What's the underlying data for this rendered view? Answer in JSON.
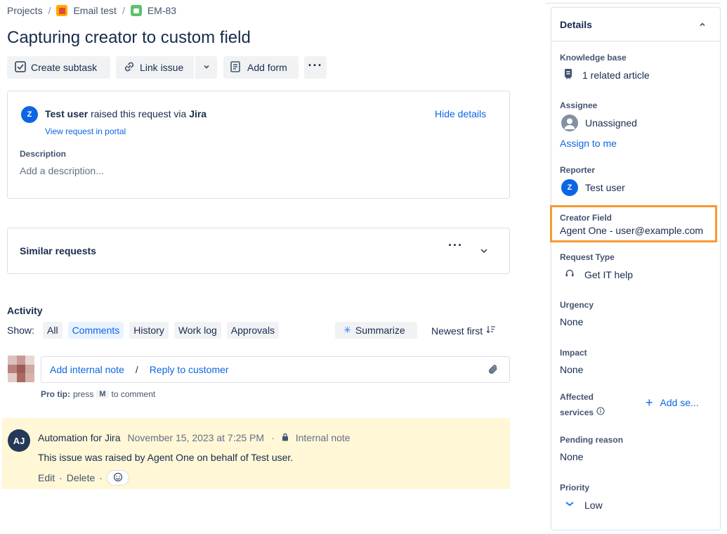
{
  "breadcrumb": {
    "projects": "Projects",
    "project": "Email test",
    "issue_key": "EM-83",
    "separator": "/"
  },
  "issue": {
    "title": "Capturing creator to custom field"
  },
  "toolbar": {
    "create_subtask": "Create subtask",
    "link_issue": "Link issue",
    "add_form": "Add form"
  },
  "request": {
    "avatar_letter": "Z",
    "user": "Test user",
    "raised_via": "raised this request via",
    "channel": "Jira",
    "hide_details": "Hide details",
    "view_portal": "View request in portal",
    "description_label": "Description",
    "description_placeholder": "Add a description..."
  },
  "similar": {
    "title": "Similar requests"
  },
  "activity": {
    "title": "Activity",
    "show_label": "Show:",
    "filters": [
      "All",
      "Comments",
      "History",
      "Work log",
      "Approvals"
    ],
    "active_filter": "Comments",
    "summarize": "Summarize",
    "sort": "Newest first",
    "add_internal_note": "Add internal note",
    "reply_separator": "/",
    "reply_to_customer": "Reply to customer",
    "pro_tip_label": "Pro tip:",
    "pro_tip_press": "press",
    "pro_tip_key": "M",
    "pro_tip_suffix": "to comment"
  },
  "comment": {
    "avatar": "AJ",
    "author": "Automation for Jira",
    "date": "November 15, 2023 at 7:25 PM",
    "visibility": "Internal note",
    "body": "This issue was raised by Agent One on behalf of Test user.",
    "edit": "Edit",
    "delete": "Delete",
    "dot": "·"
  },
  "details": {
    "header": "Details",
    "knowledge_base_label": "Knowledge base",
    "knowledge_base_value": "1 related article",
    "assignee_label": "Assignee",
    "assignee_value": "Unassigned",
    "assign_to_me": "Assign to me",
    "reporter_label": "Reporter",
    "reporter_avatar": "Z",
    "reporter_value": "Test user",
    "creator_field_label": "Creator Field",
    "creator_field_value": "Agent One - user@example.com",
    "request_type_label": "Request Type",
    "request_type_value": "Get IT help",
    "urgency_label": "Urgency",
    "urgency_value": "None",
    "impact_label": "Impact",
    "impact_value": "None",
    "affected_label_1": "Affected",
    "affected_label_2": "services",
    "affected_add": "Add se...",
    "pending_label": "Pending reason",
    "pending_value": "None",
    "priority_label": "Priority",
    "priority_value": "Low"
  },
  "colors": {
    "highlight_border": "#f79a32",
    "link": "#0c66e4",
    "comment_bg": "#fff7d6"
  }
}
